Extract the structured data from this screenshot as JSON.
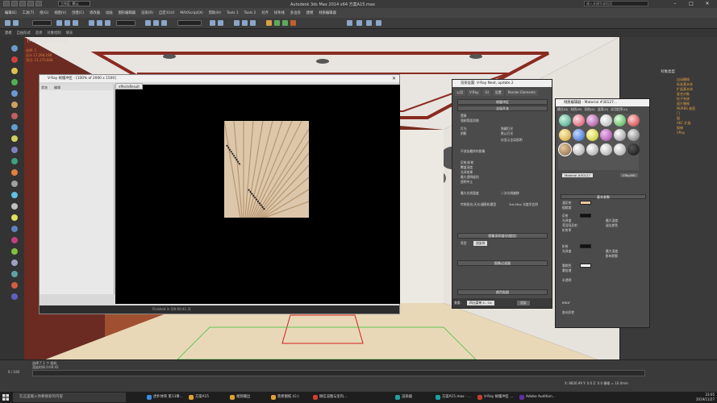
{
  "titlebar": {
    "title": "Autodesk 3ds Max  2014 x64      方案A15.max",
    "workspace": "工作区: 默认",
    "search_placeholder": "键入关键字或短语"
  },
  "menu": [
    "编辑(E)",
    "工具(T)",
    "组(G)",
    "视图(V)",
    "创建(C)",
    "修改器",
    "动画",
    "图形编辑器",
    "渲染(R)",
    "自定义(U)",
    "MAXScript(X)",
    "帮助(H)",
    "Tools 1",
    "Tools 2",
    "对齐",
    "样条线",
    "多边形",
    "建模",
    "材质编辑器"
  ],
  "ribbon": [
    "建模",
    "自由形式",
    "选择",
    "对象绘制",
    "填充"
  ],
  "viewport": {
    "label": "[+] [Camera001] [真实]",
    "info_lines": [
      "选择: 1",
      "总计 17,288,188",
      "顶点: 11,170,688"
    ]
  },
  "vfb": {
    "title": "V-Ray 帧缓冲区 - [100% of 2000 x 1500]",
    "tab": "effectsResult",
    "history_cols": [
      "状态",
      "编辑"
    ],
    "status": "Finished in [00:00:41.3]"
  },
  "render_setup": {
    "title": "渲染设置: V-Ray Next, update 2",
    "tabs": [
      "公用",
      "V-Ray",
      "GI",
      "设置",
      "Render Elements"
    ],
    "sections": [
      "帧缓冲区",
      "全局开关",
      "图像采样器(抗锯齿)",
      "图像过滤器",
      "颜色贴图"
    ],
    "options": [
      "置换",
      "强制背面消隐",
      "灯光",
      "隐藏灯光",
      "阴影",
      "默认灯光",
      "仅显示全局照明",
      "不渲染最终的图像",
      "反射/折射",
      "覆盖深度",
      "光泽效果",
      "最大透明级别",
      "透明中止",
      "最大光线强度",
      "二次光线偏移",
      "传统阳光/天光/摄影机模型",
      "3ds Max 光度学比例"
    ],
    "type_label": "类型",
    "type_value": "渲染块",
    "render_label": "渲染",
    "view_label": "查看:",
    "view_value": "四元菜单 4 - Ca",
    "render_btn": "渲染"
  },
  "mat_editor": {
    "title": "材质编辑器 - Material #30127...",
    "menu": [
      "模式(D)",
      "材质(M)",
      "导航(N)",
      "选项(O)",
      "实用程序(U)"
    ],
    "name": "Material #30127",
    "type": "VRayMtl",
    "head_basic": "基本参数",
    "labels": [
      "漫反射",
      "粗糙度",
      "反射",
      "光泽度",
      "菲涅耳反射",
      "折射率",
      "最大深度",
      "退出颜色",
      "折射",
      "光泽度",
      "最大深度",
      "影响阴影",
      "雾颜色",
      "雾倍增",
      "半透明",
      "BRDF",
      "各向异性"
    ],
    "colors": {
      "accent": "#e0a040",
      "diffuse": "#e8c8a0",
      "white": "#ffffff"
    }
  },
  "right_panel": {
    "title": "对象类型",
    "links": [
      "自动栅格",
      "标准基本体",
      "扩展基本体",
      "复合对象",
      "粒子系统",
      "面片栅格",
      "NURBS 曲面",
      "门",
      "窗",
      "AEC 扩展",
      "楼梯",
      "VRay"
    ]
  },
  "bottom": {
    "frame": "0 / 100",
    "info": [
      "选择了 1 个 相机",
      "渲染时间 0:00:42"
    ],
    "coords": "X: 8826.99  Y: 0.0  Z: 0.0  栅格 = 10.0mm"
  },
  "taskbar": {
    "search": "在这里输入你要搜索的内容",
    "tasks": [
      {
        "label": "虎扑体育 第13章..."
      },
      {
        "label": "方案A15"
      },
      {
        "label": "视频输出"
      },
      {
        "label": "装修图纸 (G:)"
      },
      {
        "label": "微信渲图与室内..."
      },
      {
        "label": "渲染器"
      },
      {
        "label": "方案A15.max - ..."
      },
      {
        "label": "V-Ray 帧缓冲区 ..."
      },
      {
        "label": "Adobe Audition..."
      }
    ],
    "time": "23:05",
    "date": "2019/11/27"
  }
}
